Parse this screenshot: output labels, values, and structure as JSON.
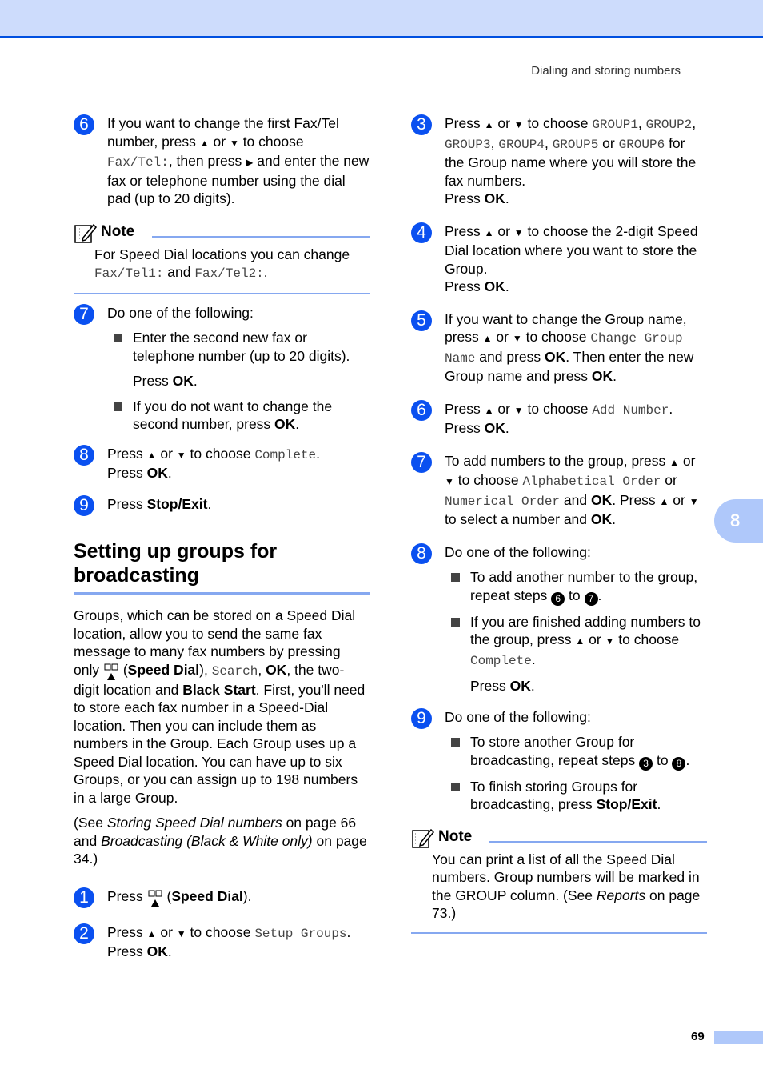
{
  "header": {
    "running_head": "Dialing and storing numbers"
  },
  "chapter_tab": "8",
  "page_number": "69",
  "left": {
    "step6": {
      "num": "6",
      "t1": "If you want to change the first Fax/Tel number, press ",
      "up": "▲",
      "or": " or ",
      "down": "▼",
      "t2": " to choose ",
      "code": "Fax/Tel:",
      "t3": ", then press ",
      "right": "▶",
      "t4": " and enter the new fax or telephone number using the dial pad (up to 20 digits)."
    },
    "note1": {
      "title": "Note",
      "t1": "For Speed Dial locations you can change ",
      "code1": "Fax/Tel1:",
      "and": " and ",
      "code2": "Fax/Tel2:",
      "end": "."
    },
    "step7": {
      "num": "7",
      "text": "Do one of the following:",
      "b1": "Enter the second new fax or telephone number (up to 20 digits).",
      "press": "Press ",
      "ok": "OK",
      "dot": ".",
      "b2": "If you do not want to change the second number, press "
    },
    "step8": {
      "num": "8",
      "t1": "Press ",
      "t2": " to choose ",
      "code": "Complete",
      "t3": ".",
      "press": "Press "
    },
    "step9": {
      "num": "9",
      "t1": "Press ",
      "bold": "Stop/Exit",
      "t2": "."
    },
    "section_title": "Setting up groups for broadcasting",
    "intro": {
      "p1": "Groups, which can be stored on a Speed Dial location, allow you to send the same fax message to many fax numbers by pressing only ",
      "speed_dial": "Speed Dial",
      "search": "Search",
      "p2": ", the two-digit location and ",
      "black_start": "Black Start",
      "p3": ". First, you'll need to store each fax number in a Speed-Dial location. Then you can include them as numbers in the Group. Each Group uses up a Speed Dial location. You can have up to six Groups, or you can assign up to 198 numbers in a large Group."
    },
    "see": {
      "open": "(See ",
      "ref1": "Storing Speed Dial numbers",
      "mid": " on page 66 and ",
      "ref2": "Broadcasting (Black & White only)",
      "end": " on page 34.)"
    },
    "step1": {
      "num": "1",
      "t1": "Press ",
      "bold": "Speed Dial"
    },
    "step2": {
      "num": "2",
      "code": "Setup Groups"
    }
  },
  "right": {
    "step3": {
      "num": "3",
      "codes": [
        "GROUP1",
        "GROUP2",
        "GROUP3",
        "GROUP4",
        "GROUP5",
        "GROUP6"
      ],
      "t": " for the Group name where you will store the fax numbers."
    },
    "step4": {
      "num": "4",
      "t": " to choose the 2-digit Speed Dial location where you want to store the Group."
    },
    "step5": {
      "num": "5",
      "t1": "If you want to change the Group name, press ",
      "code": "Change Group Name",
      "t2": " and press ",
      "t3": ". Then enter the new Group name and press "
    },
    "step6": {
      "num": "6",
      "code": "Add Number"
    },
    "step7": {
      "num": "7",
      "t1": "To add numbers to the group, press ",
      "code1": "Alphabetical Order",
      "code2": "Numerical Order",
      "t2": " and ",
      "t3": ". Press ",
      "t4": " to select a number and "
    },
    "step8": {
      "num": "8",
      "text": "Do one of the following:",
      "b1": "To add another number to the group, repeat steps ",
      "ref_a": "6",
      "to": " to ",
      "ref_b": "7",
      "b2": "If you are finished adding numbers to the group, press "
    },
    "step9": {
      "num": "9",
      "text": "Do one of the following:",
      "b1": "To store another Group for broadcasting, repeat steps ",
      "ref_a": "3",
      "ref_b": "8",
      "b2": "To finish storing Groups for broadcasting, press "
    },
    "note2": {
      "title": "Note",
      "t1": "You can print a list of all the Speed Dial numbers. Group numbers will be marked in the GROUP column. (See ",
      "ref": "Reports",
      "t2": " on page 73.)"
    }
  },
  "colors": {
    "accent_blue": "#0a50f0",
    "rule_blue": "#86a8f0",
    "header_bg": "#cddcfc"
  }
}
